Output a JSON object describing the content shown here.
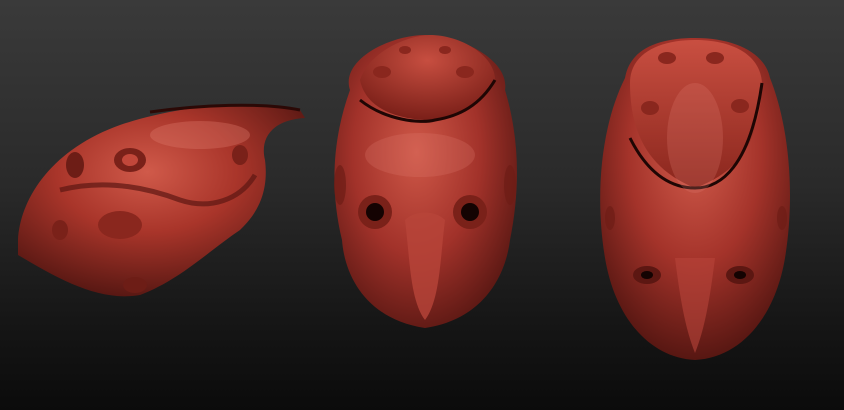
{
  "scene": {
    "background_colors": [
      "#3a3a3a",
      "#0b0b0b"
    ],
    "material_color": "#b0392c",
    "highlight_color": "#d9685a",
    "shadow_color": "#5a1612",
    "views": [
      {
        "name": "side-view"
      },
      {
        "name": "front-view"
      },
      {
        "name": "top-front-view"
      }
    ]
  }
}
